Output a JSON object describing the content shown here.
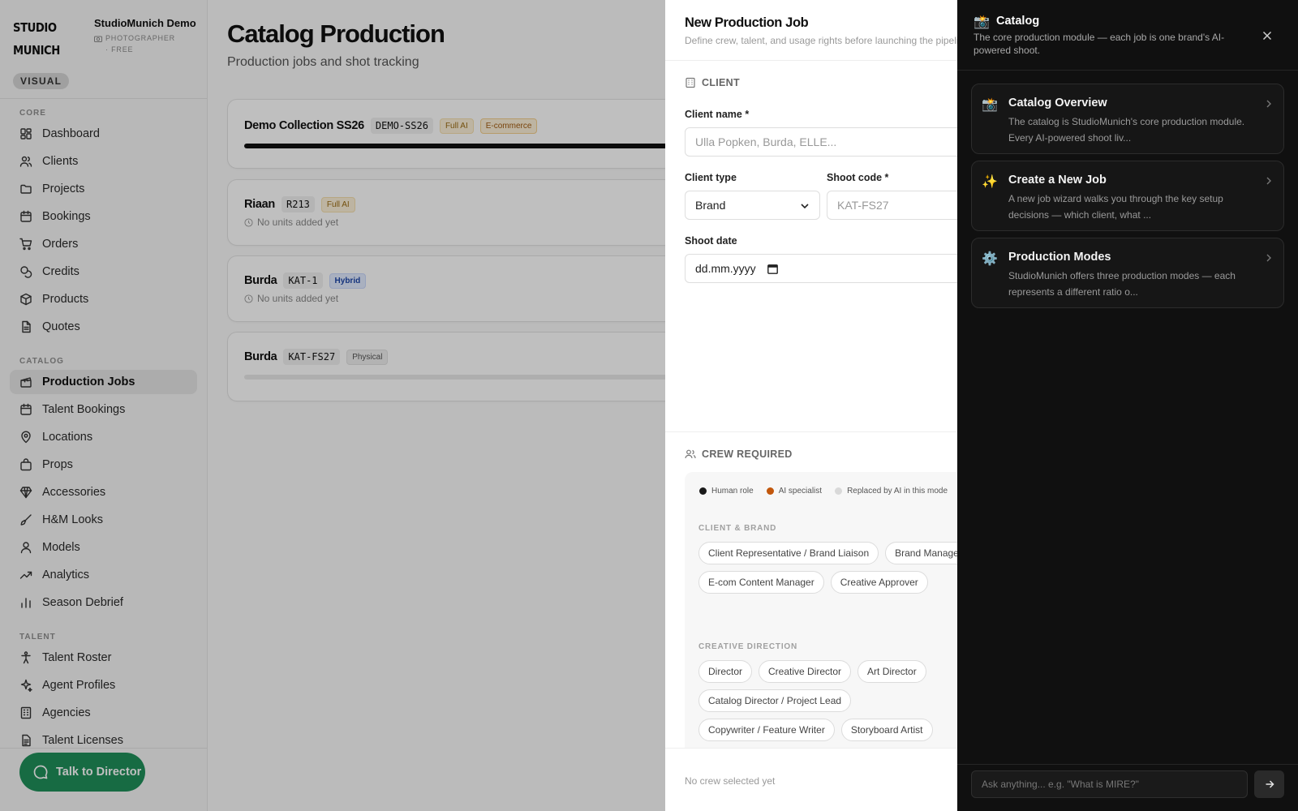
{
  "brand": {
    "logo_line1": "STUDIO",
    "logo_line2": "MUNICH",
    "badge": "VISUAL"
  },
  "workspace": {
    "name": "StudioMunich Demo",
    "plan": "PHOTOGRAPHER · FREE"
  },
  "sidebar": {
    "sections": [
      {
        "label": "CORE",
        "items": [
          {
            "label": "Dashboard",
            "icon": "dashboard-icon"
          },
          {
            "label": "Clients",
            "icon": "users-icon"
          },
          {
            "label": "Projects",
            "icon": "folder-icon"
          },
          {
            "label": "Bookings",
            "icon": "calendar-icon"
          },
          {
            "label": "Orders",
            "icon": "cart-icon"
          },
          {
            "label": "Credits",
            "icon": "coins-icon"
          },
          {
            "label": "Products",
            "icon": "box-icon"
          },
          {
            "label": "Quotes",
            "icon": "document-icon"
          }
        ]
      },
      {
        "label": "CATALOG",
        "items": [
          {
            "label": "Production Jobs",
            "icon": "clapperboard-icon",
            "active": true
          },
          {
            "label": "Talent Bookings",
            "icon": "calendar-icon"
          },
          {
            "label": "Locations",
            "icon": "map-pin-icon"
          },
          {
            "label": "Props",
            "icon": "bag-icon"
          },
          {
            "label": "Accessories",
            "icon": "gem-icon"
          },
          {
            "label": "H&M Looks",
            "icon": "brush-icon"
          },
          {
            "label": "Models",
            "icon": "user-icon"
          },
          {
            "label": "Analytics",
            "icon": "trending-up-icon"
          },
          {
            "label": "Season Debrief",
            "icon": "bar-chart-icon"
          }
        ]
      },
      {
        "label": "TALENT",
        "items": [
          {
            "label": "Talent Roster",
            "icon": "person-standing-icon"
          },
          {
            "label": "Agent Profiles",
            "icon": "sparkles-icon"
          },
          {
            "label": "Agencies",
            "icon": "building-icon"
          },
          {
            "label": "Talent Licenses",
            "icon": "license-icon"
          }
        ]
      }
    ],
    "talk_button": "Talk to Director"
  },
  "main": {
    "title": "Catalog Production",
    "subtitle": "Production jobs and shot tracking",
    "jobs": [
      {
        "name": "Demo Collection SS26",
        "code": "DEMO-SS26",
        "tags": [
          "Full AI",
          "E-commerce"
        ],
        "progress": 1.0,
        "meta": ""
      },
      {
        "name": "Riaan",
        "code": "R213",
        "tags": [
          "Full AI"
        ],
        "meta": "No units added yet"
      },
      {
        "name": "Burda",
        "code": "KAT-1",
        "tags": [
          "Hybrid"
        ],
        "meta": "No units added yet"
      },
      {
        "name": "Burda",
        "code": "KAT-FS27",
        "tags": [
          "Physical"
        ],
        "progress": 0.0,
        "meta": ""
      }
    ]
  },
  "dialog": {
    "title": "New Production Job",
    "subtitle": "Define crew, talent, and usage rights before launching the pipeline.",
    "client_section": "CLIENT",
    "client_name_label": "Client name *",
    "client_name_placeholder": "Ulla Popken, Burda, ELLE...",
    "client_type_label": "Client type",
    "client_type_value": "Brand",
    "shoot_code_label": "Shoot code *",
    "shoot_code_placeholder": "KAT-FS27",
    "shoot_date_label": "Shoot date",
    "shoot_date_placeholder": "dd.mm.yyyy",
    "crew_section": "CREW REQUIRED",
    "legend": [
      {
        "label": "Human role",
        "color": "#1a1a1a"
      },
      {
        "label": "AI specialist",
        "color": "#c2570c"
      },
      {
        "label": "Replaced by AI in this mode",
        "color": "#d9d9d9"
      }
    ],
    "groups": [
      {
        "label": "CLIENT & BRAND",
        "rows": [
          [
            "Client Representative / Brand Liaison",
            "Brand Manager"
          ],
          [
            "E-com Content Manager",
            "Creative Approver"
          ]
        ]
      },
      {
        "label": "CREATIVE DIRECTION",
        "rows": [
          [
            "Director",
            "Creative Director",
            "Art Director"
          ],
          [
            "Catalog Director / Project Lead"
          ],
          [
            "Copywriter / Feature Writer",
            "Storyboard Artist"
          ]
        ]
      }
    ],
    "footer_text": "No crew selected yet"
  },
  "help": {
    "icon": "📸",
    "title": "Catalog",
    "description": "The core production module — each job is one brand's AI-powered shoot.",
    "cards": [
      {
        "icon": "📸",
        "title": "Catalog Overview",
        "desc": "The catalog is StudioMunich's core production module. Every AI-powered shoot liv..."
      },
      {
        "icon": "✨",
        "title": "Create a New Job",
        "desc": "A new job wizard walks you through the key setup decisions — which client, what ..."
      },
      {
        "icon": "⚙️",
        "title": "Production Modes",
        "desc": "StudioMunich offers three production modes — each represents a different ratio o..."
      }
    ],
    "ask_placeholder": "Ask anything... e.g. \"What is MIRE?\""
  },
  "colors": {
    "accent_green": "#1f8f5a",
    "help_bg": "#101010"
  }
}
